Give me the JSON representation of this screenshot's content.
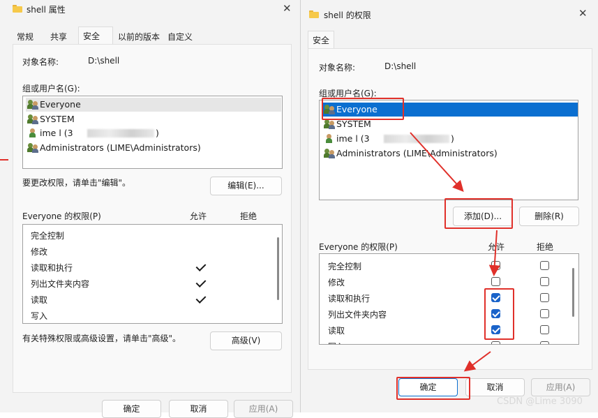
{
  "left_window": {
    "title": "shell 属性",
    "tabs": [
      "常规",
      "共享",
      "安全",
      "以前的版本",
      "自定义"
    ],
    "active_tab": "安全",
    "object_name_label": "对象名称:",
    "object_name_value": "D:\\shell",
    "group_label": "组或用户名(G):",
    "users": [
      "Everyone",
      "SYSTEM",
      "ime l (3",
      ")",
      "Administrators (LIME\\Administrators)"
    ],
    "edit_hint": "要更改权限，请单击\"编辑\"。",
    "edit_button": "编辑(E)...",
    "perm_title": "Everyone 的权限(P)",
    "allow_header": "允许",
    "deny_header": "拒绝",
    "permissions": [
      "完全控制",
      "修改",
      "读取和执行",
      "列出文件夹内容",
      "读取",
      "写入"
    ],
    "advanced_hint": "有关特殊权限或高级设置，请单击\"高级\"。",
    "advanced_button": "高级(V)",
    "ok_button": "确定",
    "cancel_button": "取消",
    "apply_button": "应用(A)"
  },
  "right_window": {
    "title": "shell 的权限",
    "tab": "安全",
    "object_name_label": "对象名称:",
    "object_name_value": "D:\\shell",
    "group_label": "组或用户名(G):",
    "users": [
      "Everyone",
      "SYSTEM",
      "ime l (3",
      ")",
      "Administrators (LIME\\Administrators)"
    ],
    "add_button": "添加(D)...",
    "remove_button": "删除(R)",
    "perm_title": "Everyone 的权限(P)",
    "allow_header": "允许",
    "deny_header": "拒绝",
    "permissions": [
      "完全控制",
      "修改",
      "读取和执行",
      "列出文件夹内容",
      "读取",
      "写入"
    ],
    "allow_checked": [
      false,
      false,
      true,
      true,
      true,
      false
    ],
    "deny_checked": [
      false,
      false,
      false,
      false,
      false,
      false
    ],
    "ok_button": "确定",
    "cancel_button": "取消",
    "apply_button": "应用(A)"
  },
  "watermark": "CSDN @Lime 3090",
  "colors": {
    "annotation_red": "#e0302a",
    "selection_blue": "#0b6fd0"
  }
}
